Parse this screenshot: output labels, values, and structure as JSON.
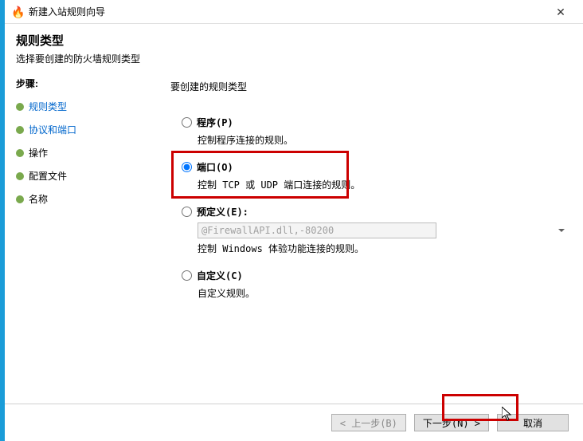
{
  "titlebar": {
    "icon": "🔥",
    "title": "新建入站规则向导",
    "close": "✕"
  },
  "header": {
    "title": "规则类型",
    "subtitle": "选择要创建的防火墙规则类型"
  },
  "sidebar": {
    "stepsLabel": "步骤:",
    "steps": [
      {
        "label": "规则类型",
        "state": "current"
      },
      {
        "label": "协议和端口",
        "state": "link"
      },
      {
        "label": "操作",
        "state": "pending"
      },
      {
        "label": "配置文件",
        "state": "pending"
      },
      {
        "label": "名称",
        "state": "pending"
      }
    ]
  },
  "content": {
    "heading": "要创建的规则类型",
    "options": [
      {
        "key": "program",
        "label": "程序(P)",
        "desc": "控制程序连接的规则。",
        "checked": false,
        "disabled": false
      },
      {
        "key": "port",
        "label": "端口(O)",
        "desc": "控制 TCP 或 UDP 端口连接的规则。",
        "checked": true,
        "disabled": false
      },
      {
        "key": "predefined",
        "label": "预定义(E):",
        "desc": "控制 Windows 体验功能连接的规则。",
        "checked": false,
        "disabled": true,
        "dropdown": "@FirewallAPI.dll,-80200"
      },
      {
        "key": "custom",
        "label": "自定义(C)",
        "desc": "自定义规则。",
        "checked": false,
        "disabled": false
      }
    ]
  },
  "footer": {
    "back": "< 上一步(B)",
    "next": "下一步(N) >",
    "cancel": "取消"
  }
}
